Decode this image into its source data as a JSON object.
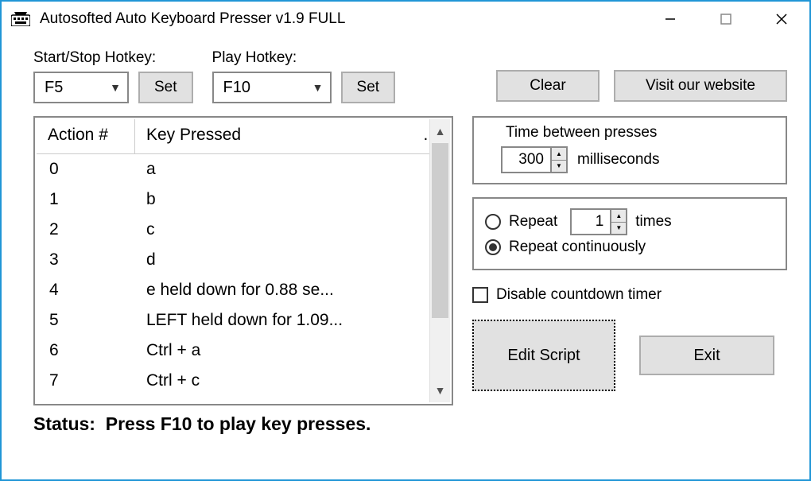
{
  "window": {
    "title": "Autosofted Auto Keyboard Presser v1.9 FULL"
  },
  "hotkeys": {
    "start_stop_label": "Start/Stop Hotkey:",
    "start_stop_value": "F5",
    "play_label": "Play Hotkey:",
    "play_value": "F10",
    "set_label": "Set"
  },
  "buttons": {
    "clear": "Clear",
    "visit": "Visit our website",
    "edit_script": "Edit Script",
    "exit": "Exit"
  },
  "list": {
    "header_action": "Action #",
    "header_key": "Key Pressed",
    "header_more": "...",
    "rows": [
      {
        "n": "0",
        "key": "a"
      },
      {
        "n": "1",
        "key": "b"
      },
      {
        "n": "2",
        "key": "c"
      },
      {
        "n": "3",
        "key": "d"
      },
      {
        "n": "4",
        "key": "e held down for 0.88 se..."
      },
      {
        "n": "5",
        "key": "LEFT held down for 1.09..."
      },
      {
        "n": "6",
        "key": "Ctrl + a"
      },
      {
        "n": "7",
        "key": "Ctrl + c"
      }
    ]
  },
  "timing": {
    "title": "Time between presses",
    "value": "300",
    "unit": "milliseconds"
  },
  "repeat": {
    "repeat_label": "Repeat",
    "repeat_times_value": "1",
    "times_label": "times",
    "continuous_label": "Repeat continuously",
    "selected": "continuous"
  },
  "disable_timer_label": "Disable countdown timer",
  "disable_timer_checked": false,
  "status": {
    "label": "Status:",
    "text": "Press F10 to play key presses."
  }
}
